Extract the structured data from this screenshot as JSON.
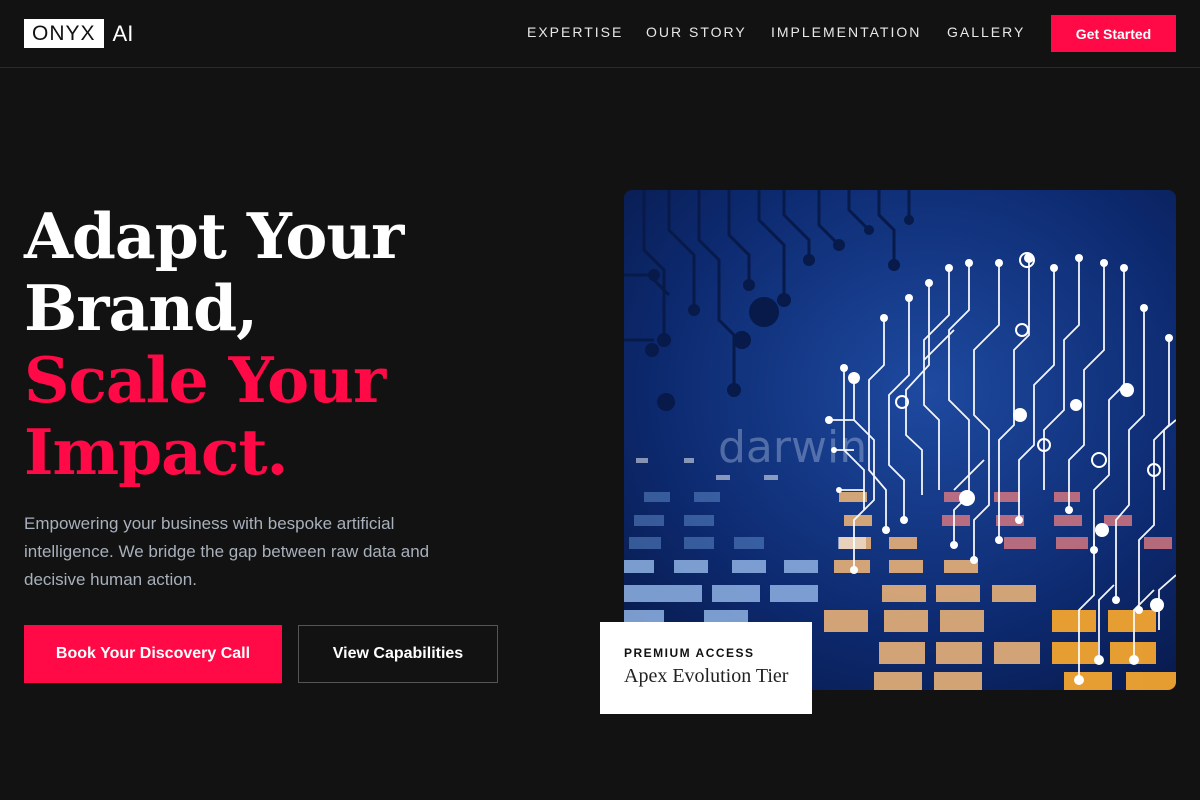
{
  "header": {
    "logo_box": "ONYX",
    "logo_suffix": "AI",
    "nav": [
      "EXPERTISE",
      "OUR STORY",
      "IMPLEMENTATION",
      "GALLERY"
    ],
    "cta": "Get Started"
  },
  "hero": {
    "headline_line1": "Adapt Your",
    "headline_line2": "Brand,",
    "headline_line3": "Scale Your",
    "headline_line4": "Impact.",
    "description": "Empowering your business with bespoke artificial intelligence. We bridge the gap between raw data and decisive human action.",
    "primary_button": "Book Your Discovery Call",
    "secondary_button": "View Capabilities"
  },
  "image_card": {
    "icon": "circuit-brain-image",
    "watermark": "darwin",
    "badge_label": "PREMIUM ACCESS",
    "badge_title": "Apex Evolution Tier"
  },
  "colors": {
    "background": "#121212",
    "accent": "#ff0a47",
    "muted_text": "#a8b0bb"
  }
}
